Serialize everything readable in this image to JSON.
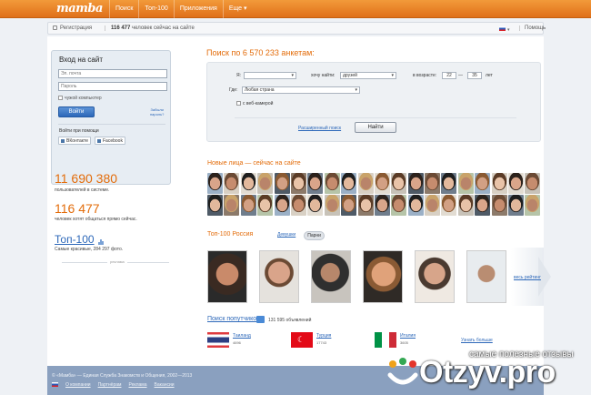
{
  "header": {
    "logo": "mamba",
    "nav": [
      "Поиск",
      "Топ-100",
      "Приложения",
      "Еще ▾"
    ]
  },
  "subbar": {
    "register": "Регистрация",
    "online_count": "116 477",
    "online_text": "человек сейчас на сайте",
    "help": "Помощь"
  },
  "login": {
    "title": "Вход на сайт",
    "email_placeholder": "Эл. почта",
    "password_placeholder": "Пароль",
    "foreign_computer": "чужой компьютер",
    "submit": "Войти",
    "forgot_line1": "Забыли",
    "forgot_line2": "пароль?",
    "via_label": "Войти при помощи",
    "vk": "ВКонтакте",
    "facebook": "Facebook"
  },
  "stats": {
    "users_count": "11 690 380",
    "users_caption": "пользователей в системе.",
    "chat_count": "116 477",
    "chat_caption": "человек хотят общаться прямо сейчас.",
    "top_link": "Топ-100",
    "top_caption": "Самые красивые, 284 297 фото.",
    "ad_label": "реклама"
  },
  "search": {
    "title": "Поиск по 6 570 233 анкетам:",
    "i_label": "Я:",
    "want_label": "хочу найти:",
    "want_value": "друзей",
    "age_label": "в возрасте:",
    "age_from": "22",
    "age_dash": "—",
    "age_to": "35",
    "age_unit": "лет",
    "where_label": "Где:",
    "where_value": "Любая страна",
    "webcam": "с веб-камерой",
    "extended": "Расширенный поиск",
    "find": "Найти"
  },
  "new_faces": {
    "title": "Новые лица — сейчас на сайте"
  },
  "top100": {
    "title": "Топ-100 Россия",
    "tab_girls": "Девушки",
    "tab_boys": "Парни",
    "see_all": "весь рейтинг"
  },
  "travel": {
    "title": "Поиск попутчиков",
    "count": "131 595 объявлений",
    "destinations": [
      {
        "name": "Таиланд",
        "count": "4696"
      },
      {
        "name": "Турция",
        "count": "17743"
      },
      {
        "name": "Италия",
        "count": "3605"
      }
    ],
    "more": "Узнать больше"
  },
  "footer": {
    "copyright": "© «Мамба» — Единая Служба Знакомств и Общения, 2002—2013",
    "links": [
      "О компании",
      "Партнёрам",
      "Реклама",
      "Вакансии"
    ]
  },
  "watermark": {
    "tagline": "самые полезные отзывы",
    "brand": "Otzyv.pro"
  },
  "colors": {
    "brand_orange": "#e36c0a",
    "link_blue": "#2d68b9",
    "footer_bg": "#8aa0bf"
  }
}
